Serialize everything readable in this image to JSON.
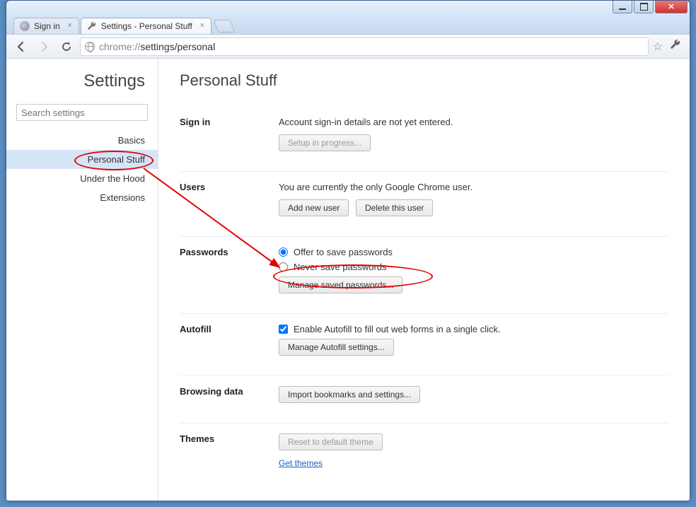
{
  "window": {
    "tabs": [
      {
        "title": "Sign in"
      },
      {
        "title": "Settings - Personal Stuff"
      }
    ]
  },
  "toolbar": {
    "url_host": "chrome://",
    "url_path": "settings/personal"
  },
  "sidebar": {
    "title": "Settings",
    "search_placeholder": "Search settings",
    "items": [
      {
        "label": "Basics"
      },
      {
        "label": "Personal Stuff"
      },
      {
        "label": "Under the Hood"
      },
      {
        "label": "Extensions"
      }
    ]
  },
  "main": {
    "title": "Personal Stuff",
    "signin": {
      "label": "Sign in",
      "text": "Account sign-in details are not yet entered.",
      "button": "Setup in progress..."
    },
    "users": {
      "label": "Users",
      "text": "You are currently the only Google Chrome user.",
      "add_button": "Add new user",
      "delete_button": "Delete this user"
    },
    "passwords": {
      "label": "Passwords",
      "offer": "Offer to save passwords",
      "never": "Never save passwords",
      "manage_button": "Manage saved passwords..."
    },
    "autofill": {
      "label": "Autofill",
      "enable": "Enable Autofill to fill out web forms in a single click.",
      "manage_button": "Manage Autofill settings..."
    },
    "browsing": {
      "label": "Browsing data",
      "import_button": "Import bookmarks and settings..."
    },
    "themes": {
      "label": "Themes",
      "reset_button": "Reset to default theme",
      "link": "Get themes"
    }
  }
}
